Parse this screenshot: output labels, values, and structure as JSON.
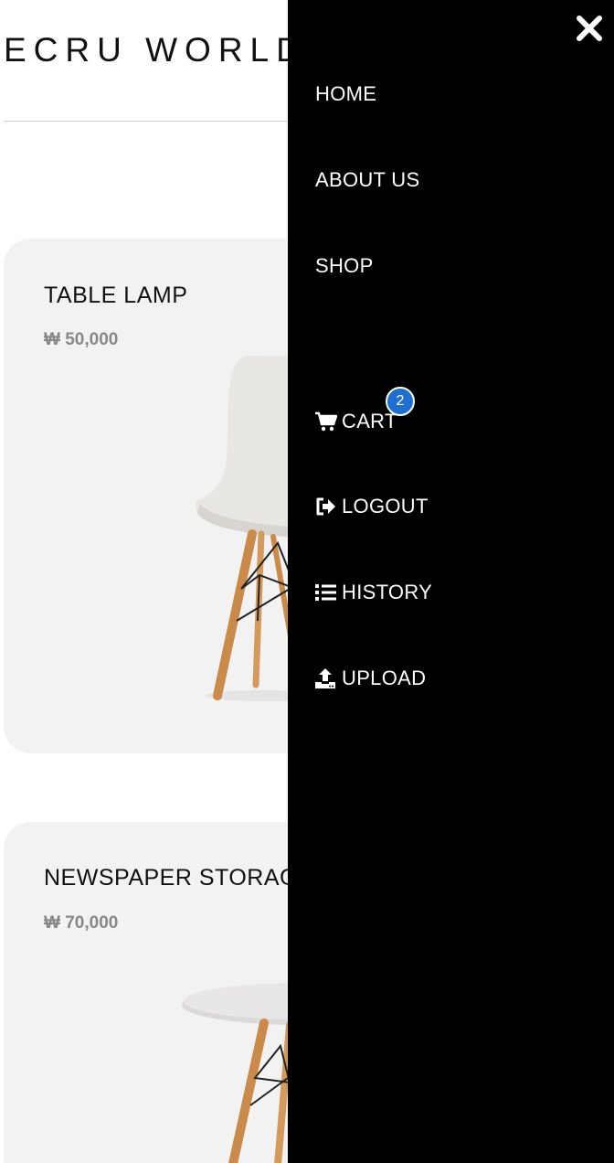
{
  "header": {
    "brand": "ECRU WORLD"
  },
  "products": [
    {
      "title": "TABLE LAMP",
      "price": "₩ 50,000",
      "image": "white-chair-image"
    },
    {
      "title": "NEWSPAPER STORAGE",
      "price": "₩ 70,000",
      "image": "round-side-table-image"
    }
  ],
  "drawer": {
    "close_icon": "close-icon",
    "nav": [
      {
        "label": "HOME"
      },
      {
        "label": "ABOUT US"
      },
      {
        "label": "SHOP"
      }
    ],
    "actions": [
      {
        "label": "CART",
        "icon": "cart-icon",
        "badge": "2"
      },
      {
        "label": "LOGOUT",
        "icon": "logout-icon"
      },
      {
        "label": "HISTORY",
        "icon": "list-icon"
      },
      {
        "label": "UPLOAD",
        "icon": "upload-icon"
      }
    ]
  },
  "colors": {
    "drawer_background": "#000000",
    "card_background": "#f2f2f2",
    "badge": "#1e6fd0",
    "price_text": "#888888"
  }
}
